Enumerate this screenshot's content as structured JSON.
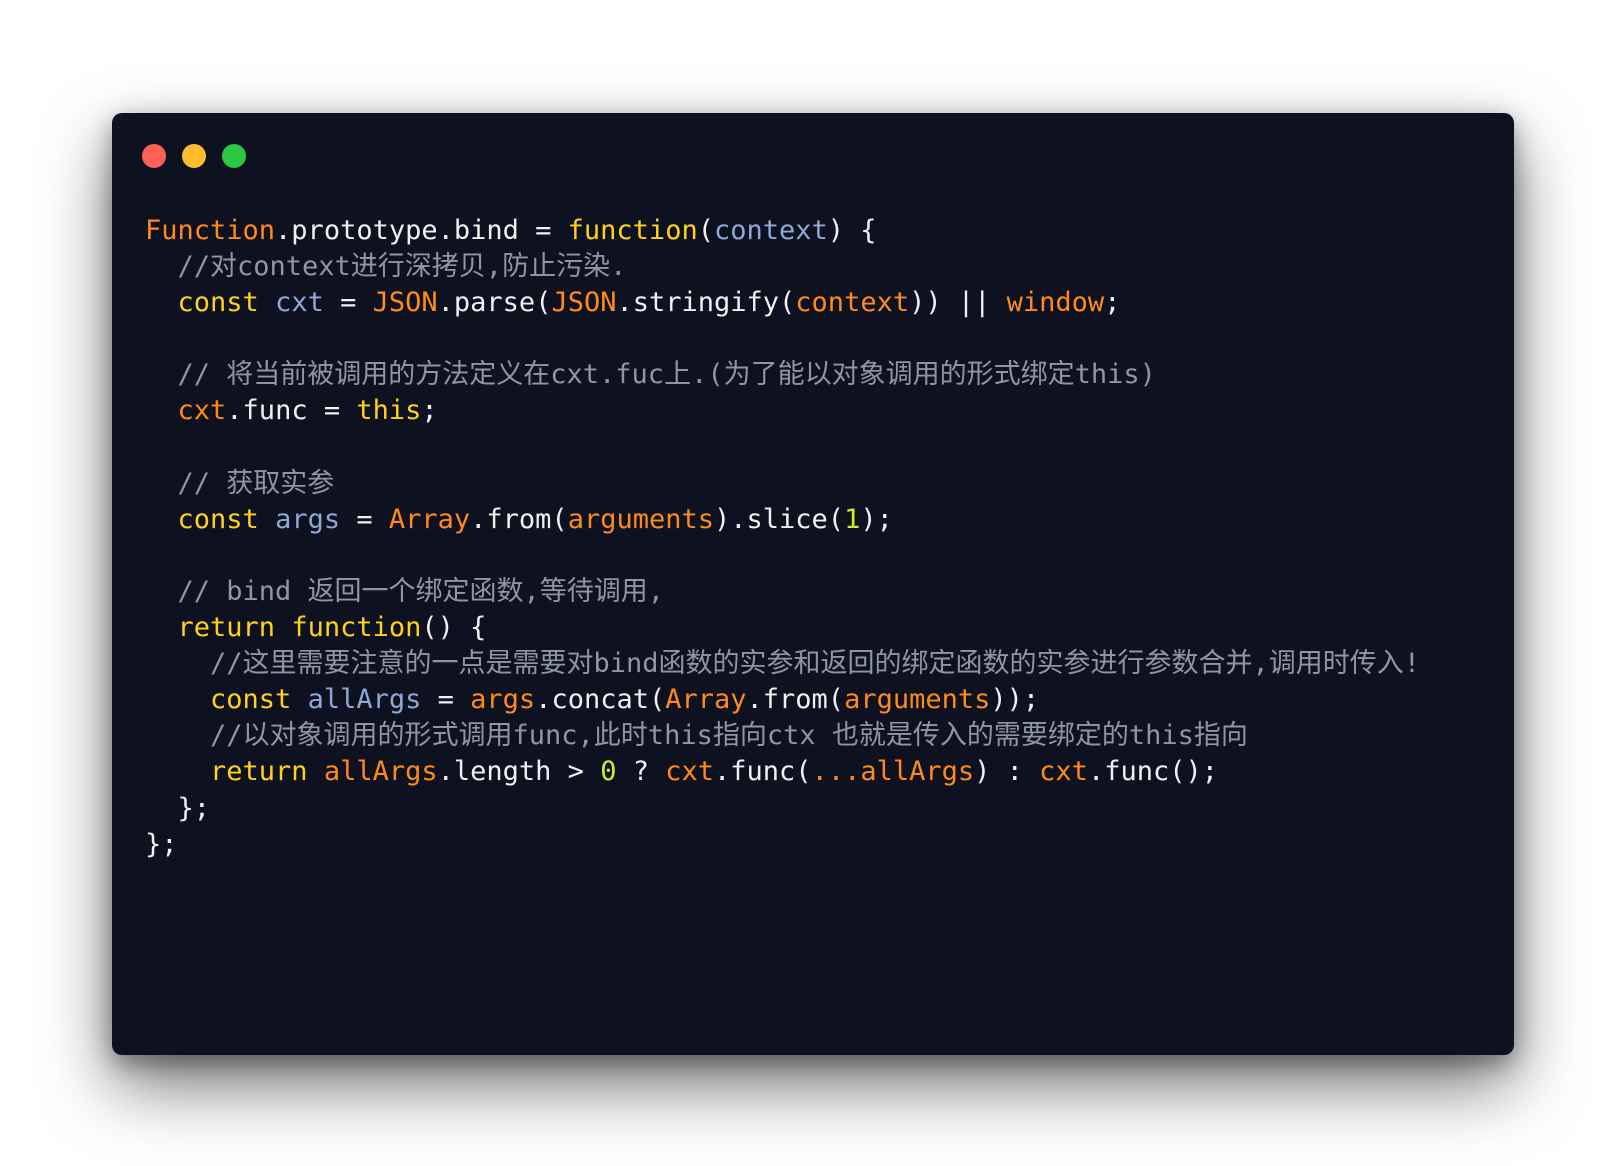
{
  "window": {
    "controls": [
      {
        "name": "close",
        "color": "#ff5f57"
      },
      {
        "name": "minimize",
        "color": "#febc2e"
      },
      {
        "name": "zoom",
        "color": "#28c840"
      }
    ]
  },
  "colors": {
    "background": "#0d1120",
    "plain": "#f0f0f0",
    "keyword": "#ffd11a",
    "identifier": "#ff8a1a",
    "parameter": "#90a8d6",
    "comment": "#8f96a3",
    "number": "#c8f02a"
  },
  "code": {
    "lines": [
      [
        {
          "t": "Function",
          "c": "ident"
        },
        {
          "t": ".prototype.bind = ",
          "c": "plain"
        },
        {
          "t": "function",
          "c": "kw"
        },
        {
          "t": "(",
          "c": "plain"
        },
        {
          "t": "context",
          "c": "param"
        },
        {
          "t": ") {",
          "c": "plain"
        }
      ],
      [
        {
          "t": "  //对context进行深拷贝,防止污染.",
          "c": "comment"
        }
      ],
      [
        {
          "t": "  ",
          "c": "plain"
        },
        {
          "t": "const",
          "c": "kw"
        },
        {
          "t": " ",
          "c": "plain"
        },
        {
          "t": "cxt",
          "c": "param"
        },
        {
          "t": " = ",
          "c": "plain"
        },
        {
          "t": "JSON",
          "c": "ident"
        },
        {
          "t": ".parse(",
          "c": "plain"
        },
        {
          "t": "JSON",
          "c": "ident"
        },
        {
          "t": ".stringify(",
          "c": "plain"
        },
        {
          "t": "context",
          "c": "ident"
        },
        {
          "t": ")) || ",
          "c": "plain"
        },
        {
          "t": "window",
          "c": "ident"
        },
        {
          "t": ";",
          "c": "plain"
        }
      ],
      [],
      [
        {
          "t": "  // 将当前被调用的方法定义在cxt.fuc上.(为了能以对象调用的形式绑定this)",
          "c": "comment"
        }
      ],
      [
        {
          "t": "  ",
          "c": "plain"
        },
        {
          "t": "cxt",
          "c": "ident"
        },
        {
          "t": ".func = ",
          "c": "plain"
        },
        {
          "t": "this",
          "c": "kw"
        },
        {
          "t": ";",
          "c": "plain"
        }
      ],
      [],
      [
        {
          "t": "  // 获取实参",
          "c": "comment"
        }
      ],
      [
        {
          "t": "  ",
          "c": "plain"
        },
        {
          "t": "const",
          "c": "kw"
        },
        {
          "t": " ",
          "c": "plain"
        },
        {
          "t": "args",
          "c": "param"
        },
        {
          "t": " = ",
          "c": "plain"
        },
        {
          "t": "Array",
          "c": "ident"
        },
        {
          "t": ".from(",
          "c": "plain"
        },
        {
          "t": "arguments",
          "c": "ident"
        },
        {
          "t": ").slice(",
          "c": "plain"
        },
        {
          "t": "1",
          "c": "num"
        },
        {
          "t": ");",
          "c": "plain"
        }
      ],
      [],
      [
        {
          "t": "  // bind 返回一个绑定函数,等待调用,",
          "c": "comment"
        }
      ],
      [
        {
          "t": "  ",
          "c": "plain"
        },
        {
          "t": "return",
          "c": "kw"
        },
        {
          "t": " ",
          "c": "plain"
        },
        {
          "t": "function",
          "c": "kw"
        },
        {
          "t": "() {",
          "c": "plain"
        }
      ],
      [
        {
          "t": "    //这里需要注意的一点是需要对bind函数的实参和返回的绑定函数的实参进行参数合并,调用时传入!",
          "c": "comment"
        }
      ],
      [
        {
          "t": "    ",
          "c": "plain"
        },
        {
          "t": "const",
          "c": "kw"
        },
        {
          "t": " ",
          "c": "plain"
        },
        {
          "t": "allArgs",
          "c": "param"
        },
        {
          "t": " = ",
          "c": "plain"
        },
        {
          "t": "args",
          "c": "ident"
        },
        {
          "t": ".concat(",
          "c": "plain"
        },
        {
          "t": "Array",
          "c": "ident"
        },
        {
          "t": ".from(",
          "c": "plain"
        },
        {
          "t": "arguments",
          "c": "ident"
        },
        {
          "t": "));",
          "c": "plain"
        }
      ],
      [
        {
          "t": "    //以对象调用的形式调用func,此时this指向ctx 也就是传入的需要绑定的this指向",
          "c": "comment"
        }
      ],
      [
        {
          "t": "    ",
          "c": "plain"
        },
        {
          "t": "return",
          "c": "kw"
        },
        {
          "t": " ",
          "c": "plain"
        },
        {
          "t": "allArgs",
          "c": "ident"
        },
        {
          "t": ".length > ",
          "c": "plain"
        },
        {
          "t": "0",
          "c": "num"
        },
        {
          "t": " ? ",
          "c": "plain"
        },
        {
          "t": "cxt",
          "c": "ident"
        },
        {
          "t": ".func(",
          "c": "plain"
        },
        {
          "t": "...allArgs",
          "c": "ident"
        },
        {
          "t": ") : ",
          "c": "plain"
        },
        {
          "t": "cxt",
          "c": "ident"
        },
        {
          "t": ".func();",
          "c": "plain"
        }
      ],
      [
        {
          "t": "  };",
          "c": "plain"
        }
      ],
      [
        {
          "t": "};",
          "c": "plain"
        }
      ]
    ]
  }
}
